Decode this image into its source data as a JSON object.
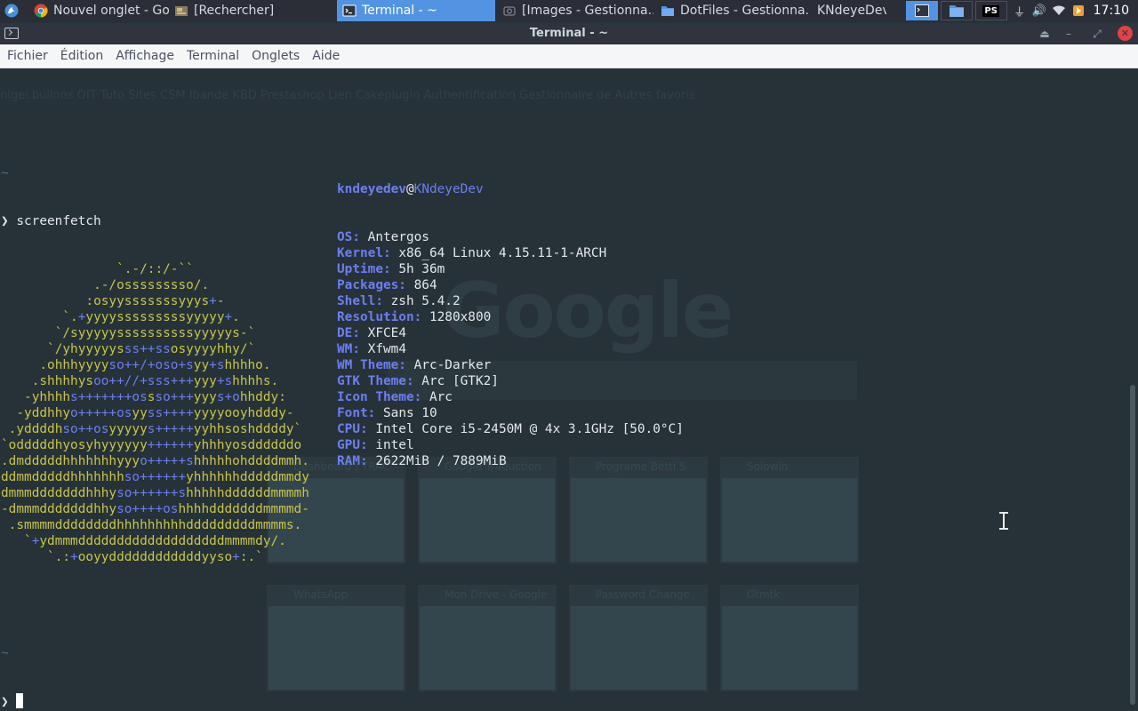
{
  "panel": {
    "tasks": [
      {
        "label": "Nouvel onglet - Goo...",
        "icon": "chrome-icon"
      },
      {
        "label": "[Rechercher]",
        "icon": "file-manager-icon"
      },
      {
        "label": "Terminal - ~",
        "icon": "terminal-icon",
        "active": true
      },
      {
        "label": "[Images - Gestionna...",
        "icon": "image-viewer-icon"
      },
      {
        "label": "DotFiles - Gestionna...",
        "icon": "folder-icon"
      },
      {
        "label": "KNdeyeDev",
        "icon": ""
      }
    ],
    "clock": "17:10",
    "launchers": [
      "terminal-launcher",
      "files-launcher",
      "phpstorm-launcher"
    ],
    "phpstorm_label": "PS"
  },
  "window": {
    "title": "Terminal - ~"
  },
  "menubar": {
    "items": [
      "Fichier",
      "Édition",
      "Affichage",
      "Terminal",
      "Onglets",
      "Aide"
    ]
  },
  "terminal": {
    "command": "screenfetch",
    "prompt_symbol": "❯",
    "tilde": "~",
    "user": "kndeyedev",
    "host": "KNdeyeDev",
    "info": [
      {
        "key": "OS:",
        "value": "Antergos"
      },
      {
        "key": "Kernel:",
        "value": "x86_64 Linux 4.15.11-1-ARCH"
      },
      {
        "key": "Uptime:",
        "value": "5h 36m"
      },
      {
        "key": "Packages:",
        "value": "864"
      },
      {
        "key": "Shell:",
        "value": "zsh 5.4.2"
      },
      {
        "key": "Resolution:",
        "value": "1280x800"
      },
      {
        "key": "DE:",
        "value": "XFCE4"
      },
      {
        "key": "WM:",
        "value": "Xfwm4"
      },
      {
        "key": "WM Theme:",
        "value": "Arc-Darker"
      },
      {
        "key": "GTK Theme:",
        "value": "Arc [GTK2]"
      },
      {
        "key": "Icon Theme:",
        "value": "Arc"
      },
      {
        "key": "Font:",
        "value": "Sans 10"
      },
      {
        "key": "CPU:",
        "value": "Intel Core i5-2450M @ 4x 3.1GHz [50.0°C]"
      },
      {
        "key": "GPU:",
        "value": "intel"
      },
      {
        "key": "RAM:",
        "value": "2622MiB / 7889MiB"
      }
    ],
    "art": [
      "               `.-/::/-``",
      "            .-/osssssssso/.",
      "           :osyysssssssyyys+-",
      "        `.+yyyysssssssssyyyyy+.",
      "       `/syyyyyssssssssssyyyyys-`",
      "      `/yhyyyyysss++ssosyyyyhhy/`",
      "     .ohhhyyyyso++/+oso+syy+shhhho.",
      "    .shhhhysoo++//+sss+++yyy+shhhhs.",
      "   -yhhhhs+++++++ossso+++yyys+ohhddy:",
      "  -yddhhyo+++++osyyss++++yyyyooyhdddy-",
      " .yddddhso++osyyyyys+++++yyhhsoshddddy`",
      "`odddddhyosyhyyyyyy++++++yhhhyosddddddo",
      ".dmdddddhhhhhhhyyyo+++++shhhhhohddddmmh.",
      "ddmmdddddhhhhhhhso++++++yhhhhhhdddddmmdy",
      "dmmmdddddddhhhyso++++++shhhhhddddddmmmmh",
      "-dmmmdddddddhhyso++++oshhhhdddddddmmmmd-",
      " .smmmmddddddddhhhhhhhhhdddddddddmmmms.",
      "   `+ydmmmdddddddddddddddddddmmmmdy/.",
      "      `.:+ooyyddddddddddddyyso+:.`"
    ]
  },
  "ghost": {
    "google_text": "Google",
    "bookmarks": "  nigel.bullons   OIT   Tuto   Sites   CSM   Ibande   KBD   Prestashop   Lien   Cakeplugin   Authentification   Gestionnaire de   Autres favoris",
    "tiles_row1": [
      "Dashboard | TRAC",
      "Google Traduction",
      "Programe Betti S",
      "Solowin"
    ],
    "tiles_row2": [
      "WhatsApp",
      "Mon Drive - Google",
      "Password Change",
      "Gtmtk"
    ]
  },
  "colors": {
    "terminal_bg": "#263238",
    "art_yellow": "#c8c44a",
    "art_blue": "#6c7ef0",
    "active_task": "#5294e2",
    "close_button": "#e14245"
  }
}
